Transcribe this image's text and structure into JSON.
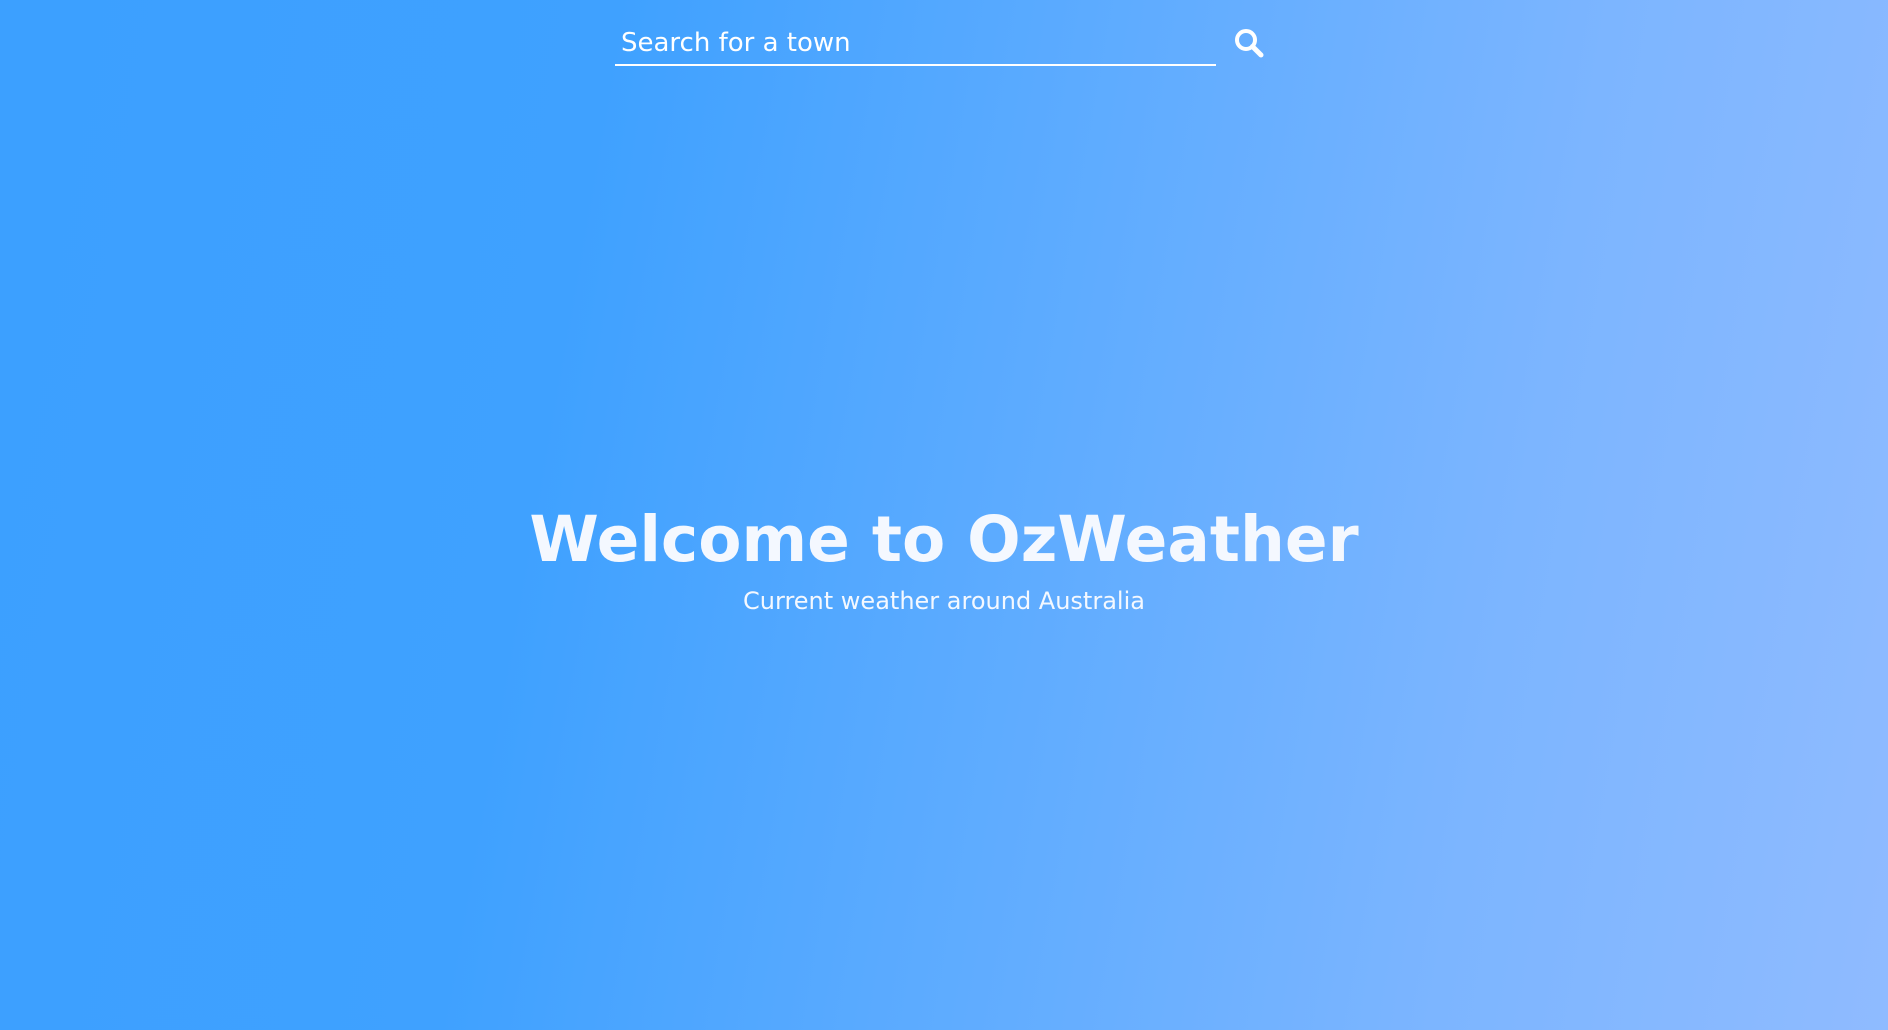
{
  "search": {
    "placeholder": "Search for a town",
    "value": "",
    "icon": "search-icon"
  },
  "hero": {
    "title": "Welcome to OzWeather",
    "subtitle": "Current weather around Australia"
  },
  "colors": {
    "background_start": "#3ca0ff",
    "background_end": "#8fbbff",
    "text": "#ffffff"
  }
}
